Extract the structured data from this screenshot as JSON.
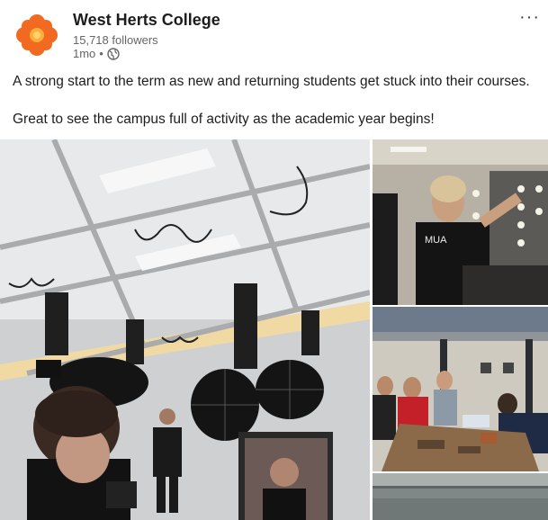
{
  "post": {
    "author": {
      "name": "West Herts College",
      "followers": "15,718 followers",
      "time": "1mo",
      "separator": "•",
      "logo_icon": "orange-flower-logo",
      "visibility_icon": "globe-icon"
    },
    "more_label": "···",
    "text": [
      "A strong start to the term as new and returning students get stuck into their courses.",
      "Great to see the campus full of activity as the academic year begins!"
    ]
  },
  "photos": {
    "main_alt": "Photography studio with ceiling rigs, umbrella lights and a student in front of a monitor",
    "right_top_alt": "Make-up student at a lit mirror",
    "right_middle_alt": "Students working at a workshop bench",
    "right_bottom_alt": "Ceiling of a workshop",
    "shirt_text": "MUA"
  },
  "colors": {
    "brand_orange": "#f26a21",
    "text_primary": "#1d1d1d",
    "text_secondary": "#666666"
  }
}
